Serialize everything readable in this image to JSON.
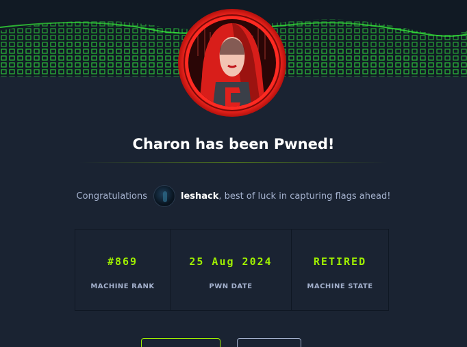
{
  "machine": {
    "title": "Charon has been Pwned!"
  },
  "congrats": {
    "prefix": "Congratulations",
    "username": "leshack",
    "suffix": ", best of luck in capturing flags ahead!"
  },
  "stats": [
    {
      "value": "#869",
      "label": "MACHINE RANK"
    },
    {
      "value": "25 Aug 2024",
      "label": "PWN DATE"
    },
    {
      "value": "RETIRED",
      "label": "MACHINE STATE"
    }
  ],
  "icons": {
    "machine_avatar": "hooded-figure-avatar-icon",
    "user_avatar": "user-avatar-icon"
  },
  "colors": {
    "background": "#1a2332",
    "accent": "#9fef00",
    "avatar_ring": "#e0201c",
    "text_muted": "#a4b1cd"
  }
}
